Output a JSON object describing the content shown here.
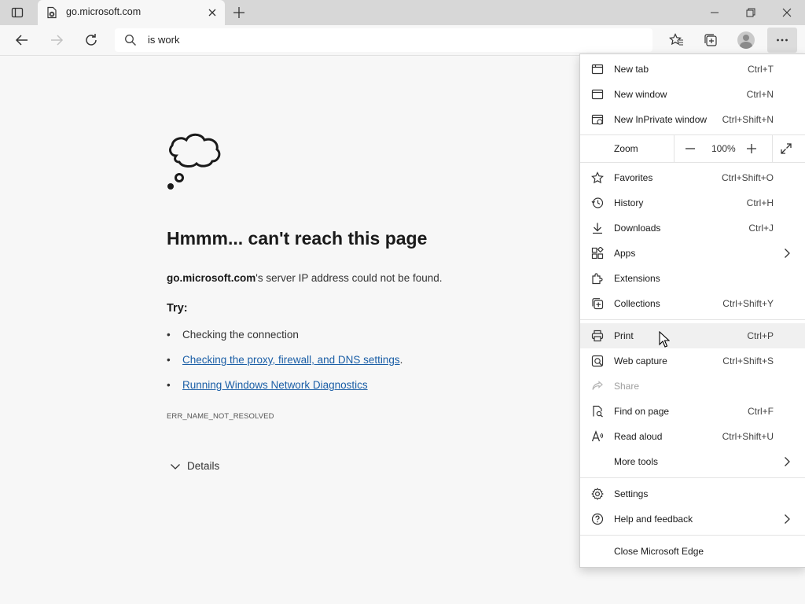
{
  "tab": {
    "title": "go.microsoft.com"
  },
  "address": {
    "value": "is work"
  },
  "error": {
    "title": "Hmmm... can't reach this page",
    "host": "go.microsoft.com",
    "message": "'s server IP address could not be found.",
    "try_label": "Try:",
    "suggestions": [
      {
        "text": "Checking the connection"
      },
      {
        "text": "Checking the proxy, firewall, and DNS settings",
        "suffix": "."
      },
      {
        "text": "Running Windows Network Diagnostics"
      }
    ],
    "code": "ERR_NAME_NOT_RESOLVED",
    "details_label": "Details"
  },
  "menu": {
    "items": [
      {
        "label": "New tab",
        "shortcut": "Ctrl+T",
        "icon": "new-tab-icon"
      },
      {
        "label": "New window",
        "shortcut": "Ctrl+N",
        "icon": "new-window-icon"
      },
      {
        "label": "New InPrivate window",
        "shortcut": "Ctrl+Shift+N",
        "icon": "inprivate-icon"
      },
      {
        "label": "Favorites",
        "shortcut": "Ctrl+Shift+O",
        "icon": "favorites-icon"
      },
      {
        "label": "History",
        "shortcut": "Ctrl+H",
        "icon": "history-icon"
      },
      {
        "label": "Downloads",
        "shortcut": "Ctrl+J",
        "icon": "download-icon"
      },
      {
        "label": "Apps",
        "shortcut": "",
        "icon": "apps-icon"
      },
      {
        "label": "Extensions",
        "shortcut": "",
        "icon": "extensions-icon"
      },
      {
        "label": "Collections",
        "shortcut": "Ctrl+Shift+Y",
        "icon": "collections-icon"
      },
      {
        "label": "Print",
        "shortcut": "Ctrl+P",
        "icon": "print-icon"
      },
      {
        "label": "Web capture",
        "shortcut": "Ctrl+Shift+S",
        "icon": "web-capture-icon"
      },
      {
        "label": "Share",
        "shortcut": "",
        "icon": "share-icon"
      },
      {
        "label": "Find on page",
        "shortcut": "Ctrl+F",
        "icon": "find-icon"
      },
      {
        "label": "Read aloud",
        "shortcut": "Ctrl+Shift+U",
        "icon": "read-aloud-icon"
      },
      {
        "label": "More tools",
        "shortcut": "",
        "icon": ""
      },
      {
        "label": "Settings",
        "shortcut": "",
        "icon": "settings-icon"
      },
      {
        "label": "Help and feedback",
        "shortcut": "",
        "icon": "help-icon"
      },
      {
        "label": "Close Microsoft Edge",
        "shortcut": "",
        "icon": ""
      }
    ],
    "zoom": {
      "label": "Zoom",
      "value": "100%"
    }
  }
}
